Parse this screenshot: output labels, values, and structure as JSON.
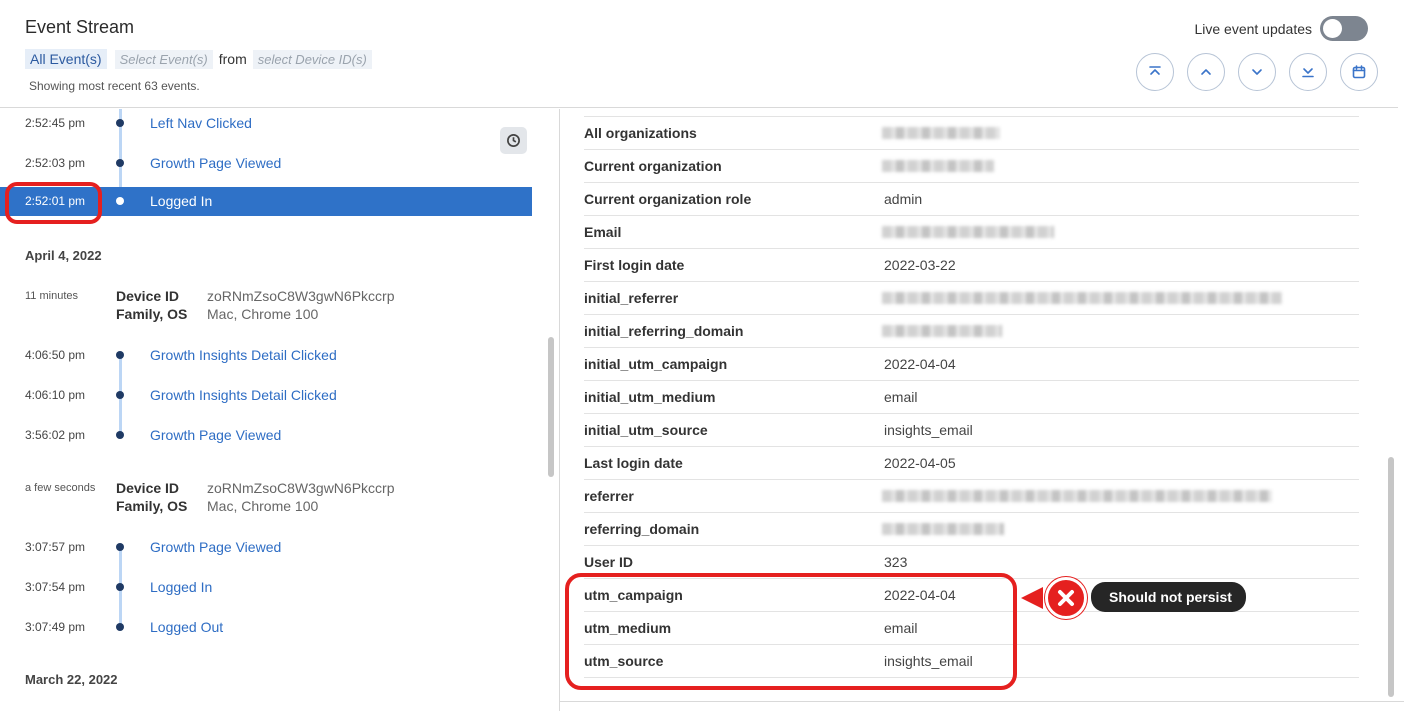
{
  "header": {
    "title": "Event Stream",
    "filters": {
      "all_events": "All Event(s)",
      "select_events_placeholder": "Select Event(s)",
      "from": "from",
      "select_device_placeholder": "select Device ID(s)"
    },
    "showing": "Showing most recent 63 events.",
    "live_label": "Live event updates",
    "live_on": false,
    "nav_buttons": [
      "jump-to-top-icon",
      "previous-icon",
      "next-icon",
      "jump-to-bottom-icon",
      "calendar-icon"
    ]
  },
  "timeline": {
    "top_events": [
      {
        "time": "2:52:45 pm",
        "name": "Left Nav Clicked"
      },
      {
        "time": "2:52:03 pm",
        "name": "Growth Page Viewed"
      },
      {
        "time": "2:52:01 pm",
        "name": "Logged In",
        "selected": true
      }
    ],
    "section1": {
      "date": "April 4, 2022",
      "device": {
        "ago": "11 minutes",
        "key1": "Device ID",
        "key2": "Family, OS",
        "device_id": "zoRNmZsoC8W3gwN6Pkccrp",
        "family_os": "Mac, Chrome 100"
      },
      "events": [
        {
          "time": "4:06:50 pm",
          "name": "Growth Insights Detail Clicked"
        },
        {
          "time": "4:06:10 pm",
          "name": "Growth Insights Detail Clicked"
        },
        {
          "time": "3:56:02 pm",
          "name": "Growth Page Viewed"
        }
      ]
    },
    "section2": {
      "device": {
        "ago": "a few seconds",
        "key1": "Device ID",
        "key2": "Family, OS",
        "device_id": "zoRNmZsoC8W3gwN6Pkccrp",
        "family_os": "Mac, Chrome 100"
      },
      "events": [
        {
          "time": "3:07:57 pm",
          "name": "Growth Page Viewed"
        },
        {
          "time": "3:07:54 pm",
          "name": "Logged In"
        },
        {
          "time": "3:07:49 pm",
          "name": "Logged Out"
        }
      ]
    },
    "next_date": "March 22, 2022"
  },
  "properties": [
    {
      "key": "All organizations",
      "value": "",
      "redacted": true
    },
    {
      "key": "Current organization",
      "value": "",
      "redacted": true
    },
    {
      "key": "Current organization role",
      "value": "admin"
    },
    {
      "key": "Email",
      "value": "",
      "redacted": true
    },
    {
      "key": "First login date",
      "value": "2022-03-22"
    },
    {
      "key": "initial_referrer",
      "value": "",
      "redacted": true
    },
    {
      "key": "initial_referring_domain",
      "value": "",
      "redacted": true
    },
    {
      "key": "initial_utm_campaign",
      "value": "2022-04-04"
    },
    {
      "key": "initial_utm_medium",
      "value": "email"
    },
    {
      "key": "initial_utm_source",
      "value": "insights_email"
    },
    {
      "key": "Last login date",
      "value": "2022-04-05"
    },
    {
      "key": "referrer",
      "value": "",
      "redacted": true
    },
    {
      "key": "referring_domain",
      "value": "",
      "redacted": true
    },
    {
      "key": "User ID",
      "value": "323"
    },
    {
      "key": "utm_campaign",
      "value": "2022-04-04"
    },
    {
      "key": "utm_medium",
      "value": "email"
    },
    {
      "key": "utm_source",
      "value": "insights_email"
    }
  ],
  "annotation": {
    "callout": "Should not persist",
    "color": "#e5201f"
  }
}
